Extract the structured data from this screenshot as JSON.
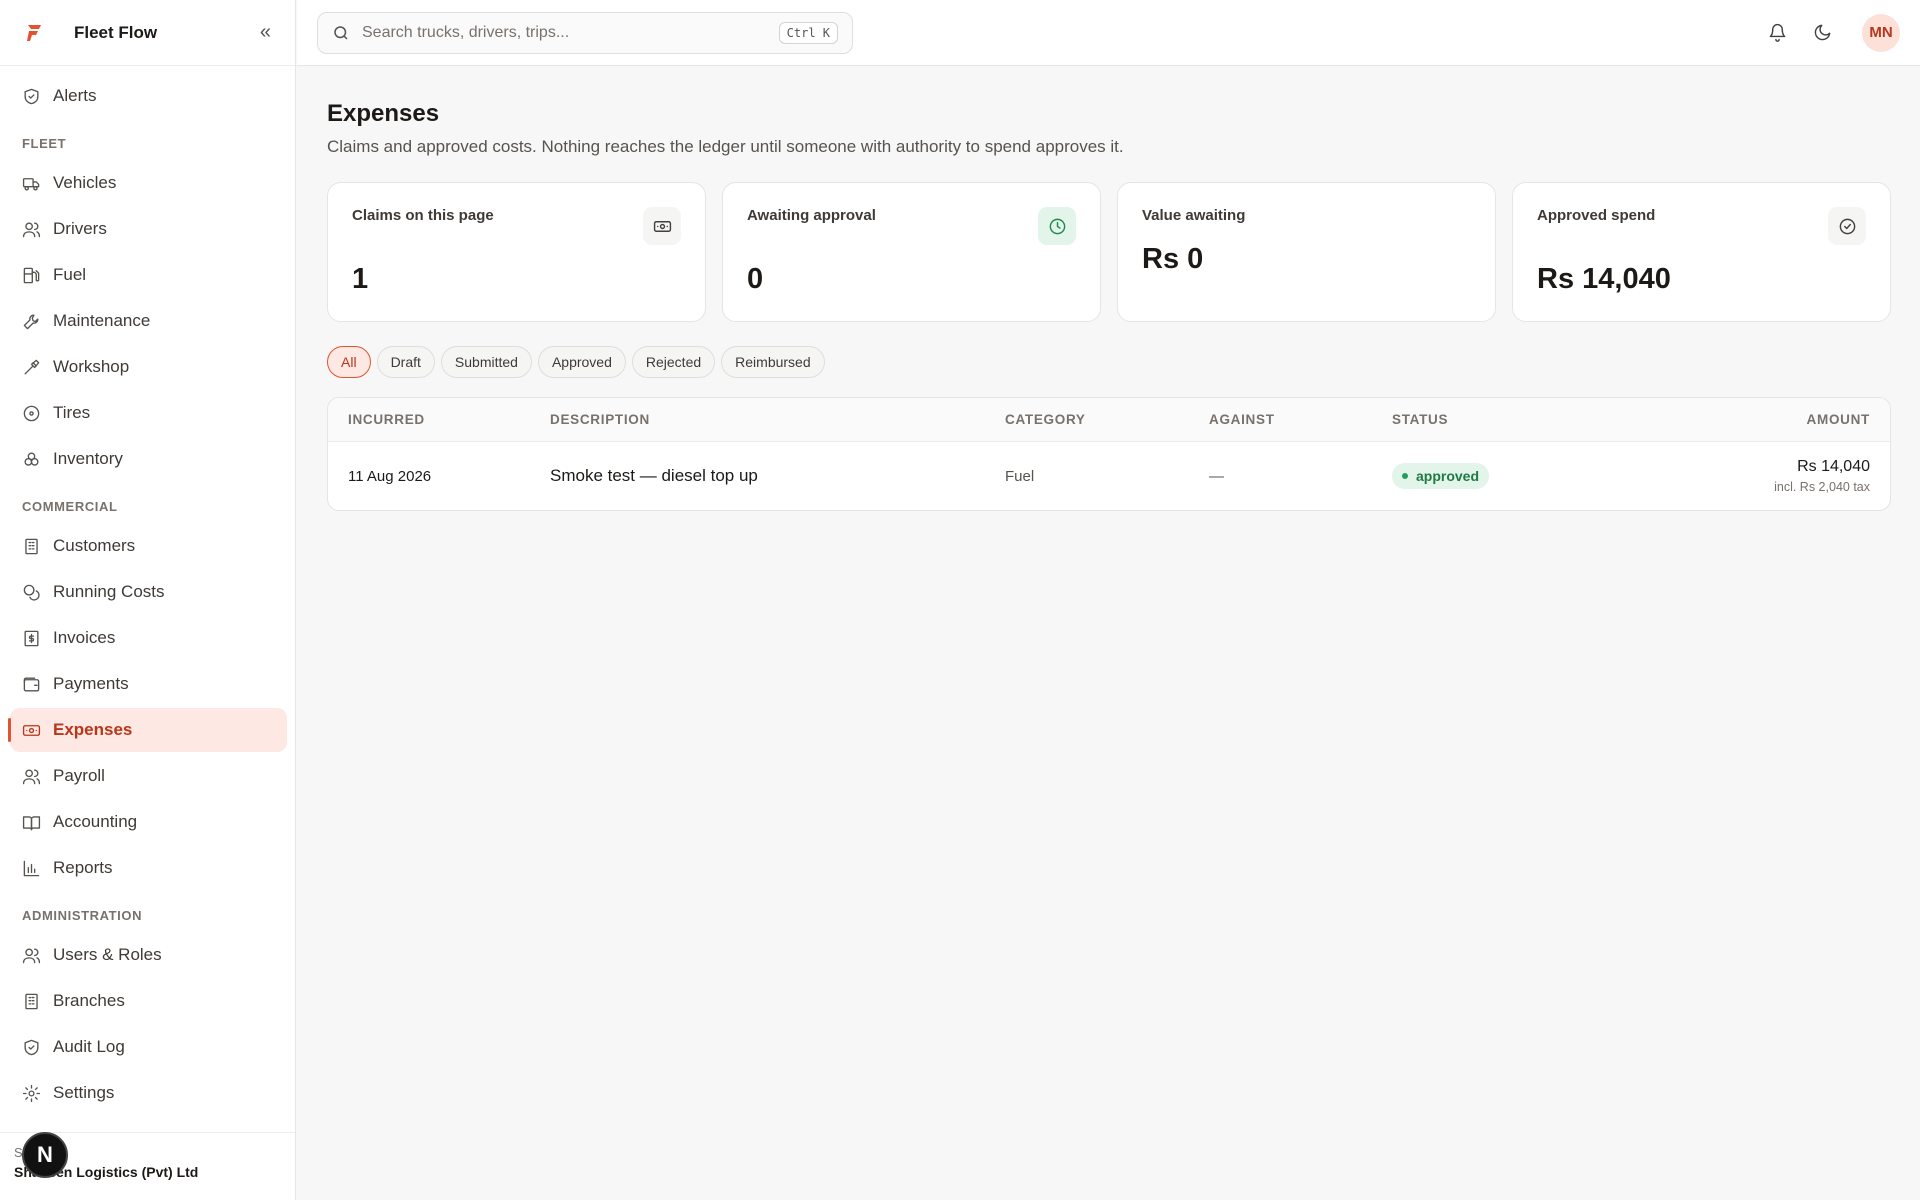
{
  "app": {
    "name": "Fleet Flow"
  },
  "sidebar": {
    "top_item": "Alerts",
    "sections": {
      "fleet": "FLEET",
      "commercial": "COMMERCIAL",
      "administration": "ADMINISTRATION"
    },
    "fleet_items": [
      "Vehicles",
      "Drivers",
      "Fuel",
      "Maintenance",
      "Workshop",
      "Tires",
      "Inventory"
    ],
    "commercial_items": [
      "Customers",
      "Running Costs",
      "Invoices",
      "Payments",
      "Expenses",
      "Payroll",
      "Accounting",
      "Reports"
    ],
    "admin_items": [
      "Users & Roles",
      "Branches",
      "Audit Log",
      "Settings"
    ],
    "active_item": "Expenses",
    "footer": {
      "switch_label": "Switch to",
      "org_name": "Shaheen Logistics (Pvt) Ltd",
      "badge": "N"
    }
  },
  "topbar": {
    "search_placeholder": "Search trucks, drivers, trips...",
    "shortcut": "Ctrl K",
    "avatar_initials": "MN"
  },
  "page": {
    "title": "Expenses",
    "subtitle": "Claims and approved costs. Nothing reaches the ledger until someone with authority to spend approves it."
  },
  "cards": [
    {
      "label": "Claims on this page",
      "value": "1"
    },
    {
      "label": "Awaiting approval",
      "value": "0"
    },
    {
      "label": "Value awaiting",
      "value": "Rs 0"
    },
    {
      "label": "Approved spend",
      "value": "Rs 14,040"
    }
  ],
  "filters": [
    "All",
    "Draft",
    "Submitted",
    "Approved",
    "Rejected",
    "Reimbursed"
  ],
  "active_filter": "All",
  "table": {
    "headers": [
      "INCURRED",
      "DESCRIPTION",
      "CATEGORY",
      "AGAINST",
      "STATUS",
      "AMOUNT"
    ],
    "rows": [
      {
        "incurred": "11 Aug 2026",
        "description": "Smoke test — diesel top up",
        "category": "Fuel",
        "against": "—",
        "status": "approved",
        "amount": "Rs 14,040",
        "tax_note": "incl. Rs 2,040 tax"
      }
    ]
  },
  "colors": {
    "accent": "#e2532f",
    "active_bg": "#fde8e3",
    "success": "#1f8a4c"
  }
}
